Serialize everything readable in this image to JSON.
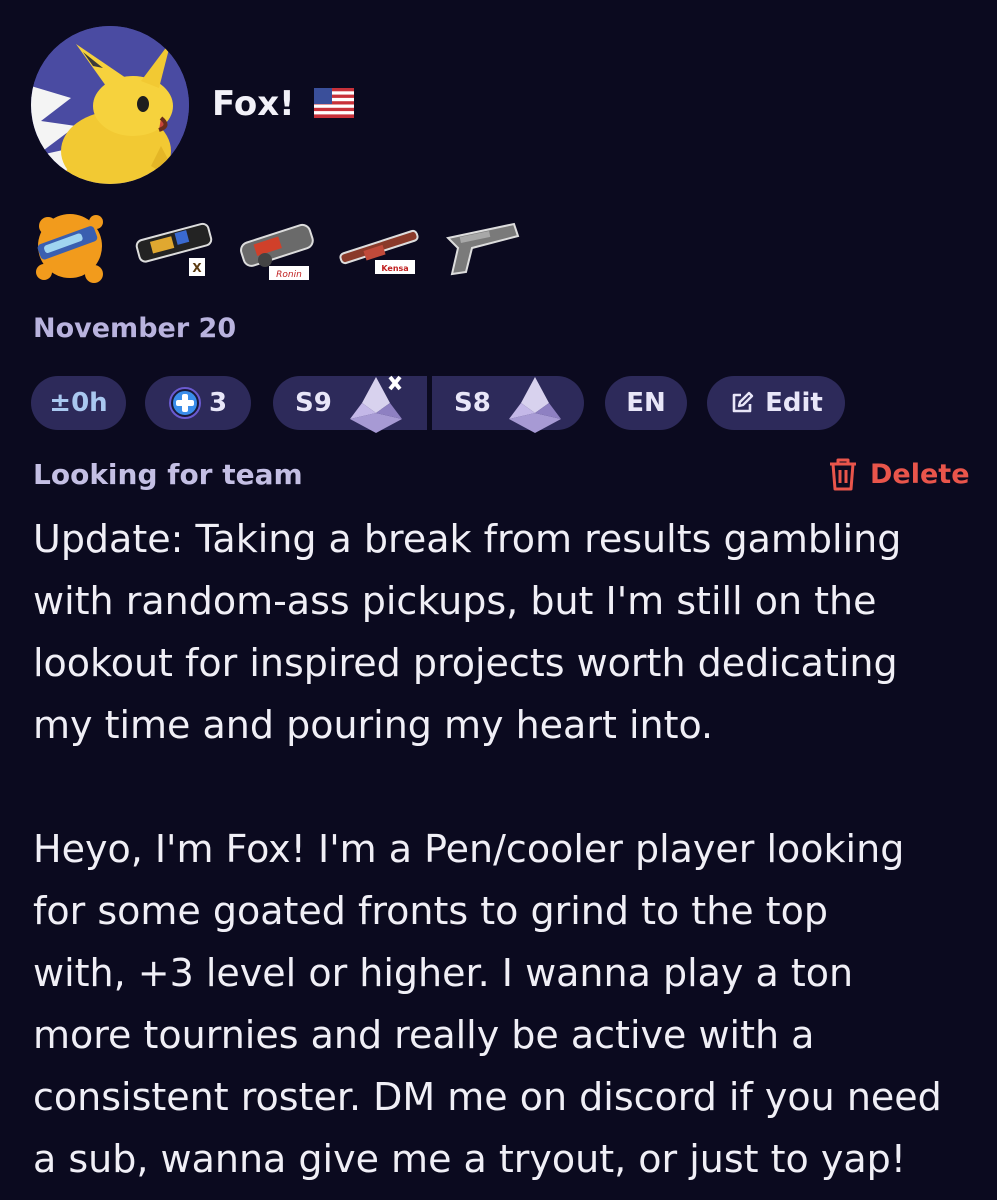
{
  "profile": {
    "username": "Fox!",
    "flag_icon": "us-flag-icon",
    "avatar_icon": "jolteon-avatar",
    "date": "November 20"
  },
  "weapons": [
    {
      "icon": "splattershot-icon",
      "badge": ""
    },
    {
      "icon": "heavy-splatling-icon",
      "badge": "X"
    },
    {
      "icon": "nautilus-icon",
      "badge": "Ronin"
    },
    {
      "icon": "charger-icon",
      "badge": "Kensa"
    },
    {
      "icon": "blaster-icon",
      "badge": ""
    }
  ],
  "stats": {
    "timezone": "±0h",
    "plus_level": "3",
    "season_1": "S9",
    "season_2": "S8",
    "language": "EN",
    "edit_label": "Edit"
  },
  "post": {
    "status": "Looking for team",
    "delete_label": "Delete",
    "bio": "Update: Taking a break from results gambling\nwith random-ass pickups, but I'm still on the\nlookout for inspired projects worth dedicating\nmy time and pouring my heart into.\n\nHeyo, I'm Fox! I'm a Pen/cooler player looking\nfor some goated fronts to grind to the top\nwith, +3 level or higher. I wanna play a ton\nmore tournies and really be active with a\nconsistent roster. DM me on discord if you need\na sub, wanna give me a tryout, or just to yap!"
  },
  "colors": {
    "background": "#0b0a1f",
    "pill": "#2d2a5a",
    "muted_text": "#b9b3de",
    "danger": "#e9554b",
    "plus_badge": "#3a8dea"
  }
}
